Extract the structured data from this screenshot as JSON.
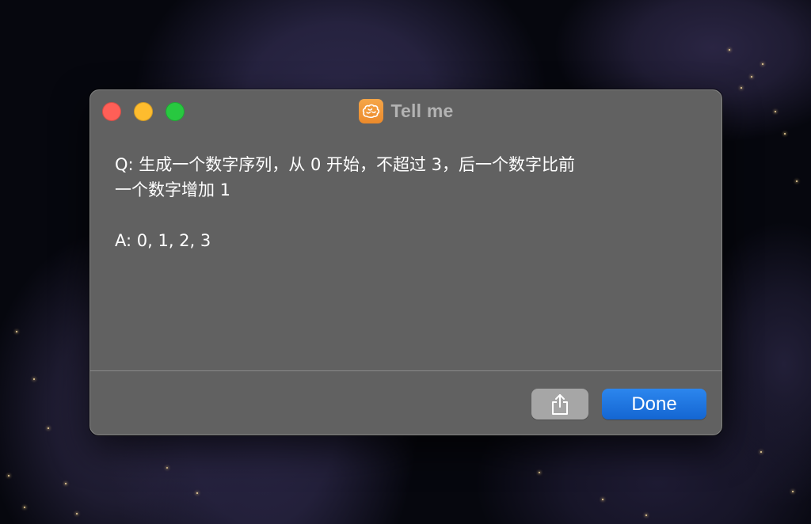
{
  "window": {
    "title": "Tell me",
    "app_icon": "brain-icon"
  },
  "content": {
    "question_line1": "Q: 生成一个数字序列，从 0 开始，不超过 3，后一个数字比前",
    "question_line2": "一个数字增加 1",
    "answer": "A: 0, 1, 2, 3"
  },
  "buttons": {
    "share_icon": "share-icon",
    "done_label": "Done"
  },
  "colors": {
    "window_bg": "#616161",
    "accent_blue": "#1a73e1",
    "app_icon_orange": "#f09a3a",
    "traffic_close": "#ff5f57",
    "traffic_minimize": "#febc2e",
    "traffic_zoom": "#28c840"
  }
}
